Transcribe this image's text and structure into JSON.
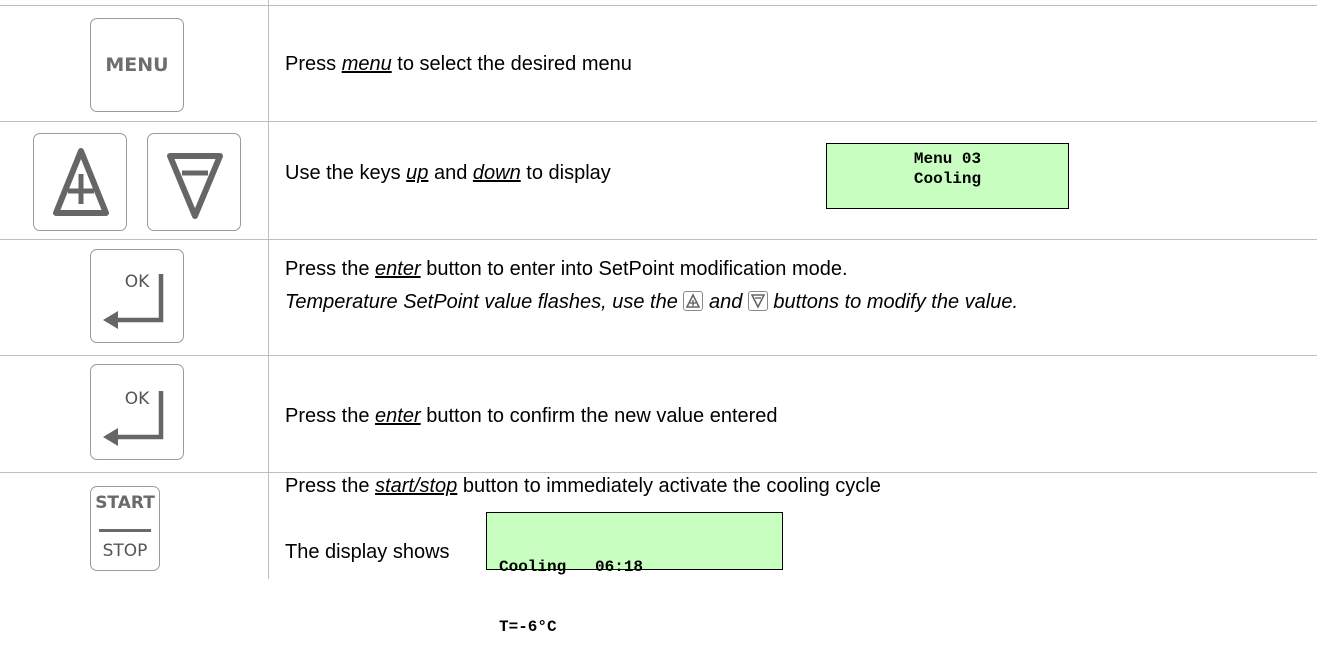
{
  "rows": [
    {
      "key_label": "MENU",
      "text_before": "Press ",
      "keyword": "menu",
      "text_after": " to select the desired menu"
    },
    {
      "text_before": "Use the keys ",
      "keyword1": "up",
      "text_mid": " and ",
      "keyword2": "down",
      "text_after": " to display",
      "display_line1": "Menu 03",
      "display_line2": "Cooling"
    },
    {
      "key_label": "OK",
      "text_before": "Press the ",
      "keyword": "enter",
      "text_after": " button to enter into SetPoint modification mode.",
      "italic_before": "Temperature SetPoint value flashes, use the ",
      "italic_mid": " and ",
      "italic_after": " buttons to modify the value."
    },
    {
      "key_label": "OK",
      "text_before": "Press the ",
      "keyword": "enter",
      "text_after": " button to confirm the new value entered"
    },
    {
      "key_label_top": "START",
      "key_label_bottom": "STOP",
      "text_before": "Press the ",
      "keyword": "start/stop",
      "text_after": " button to immediately activate the cooling cycle",
      "display_intro": "The display shows",
      "display_line1": "Cooling   06:18",
      "display_line2": "T=-6°C"
    }
  ],
  "icons": [
    "menu-key",
    "up-key",
    "down-key",
    "ok-enter-key",
    "start-stop-key"
  ]
}
